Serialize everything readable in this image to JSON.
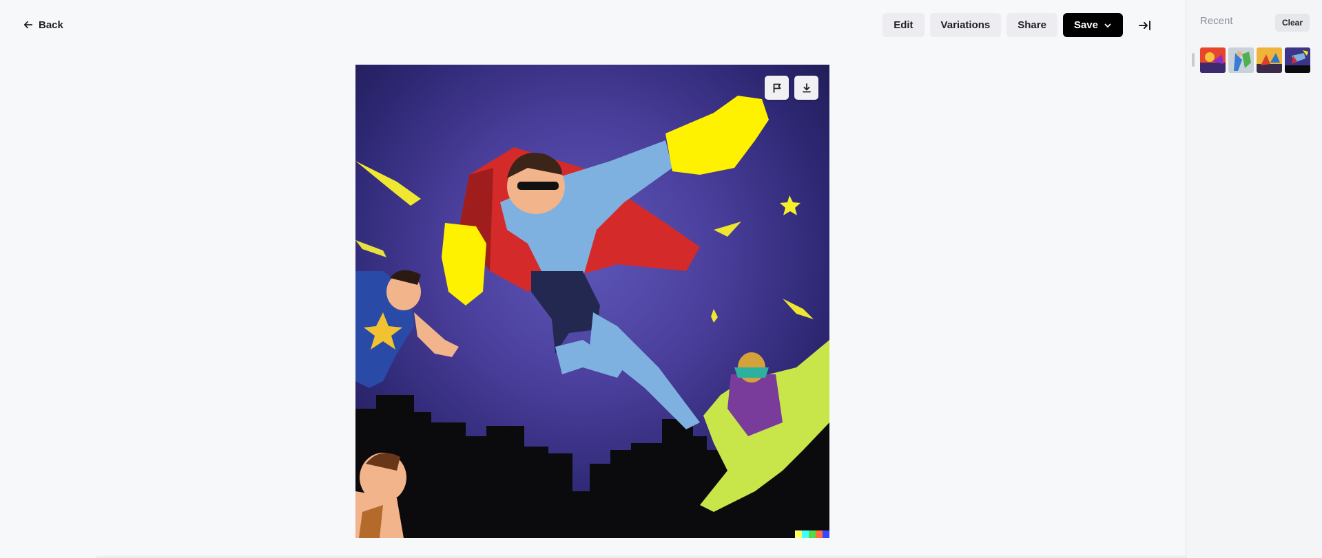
{
  "header": {
    "back_label": "Back",
    "edit_label": "Edit",
    "variations_label": "Variations",
    "share_label": "Share",
    "save_label": "Save"
  },
  "image": {
    "actions": [
      "flag-icon",
      "download-icon"
    ],
    "watermark_colors": [
      "#ffff66",
      "#42ffff",
      "#51da4c",
      "#ff6e3c",
      "#3c46ff"
    ]
  },
  "sidebar": {
    "title": "Recent",
    "clear_label": "Clear",
    "thumbnails": [
      {
        "name": "recent-thumb-1"
      },
      {
        "name": "recent-thumb-2"
      },
      {
        "name": "recent-thumb-3"
      },
      {
        "name": "recent-thumb-4"
      }
    ]
  },
  "colors": {
    "accent_dark": "#000000",
    "button_bg": "#ececf1",
    "page_bg": "#f7f8fa"
  }
}
